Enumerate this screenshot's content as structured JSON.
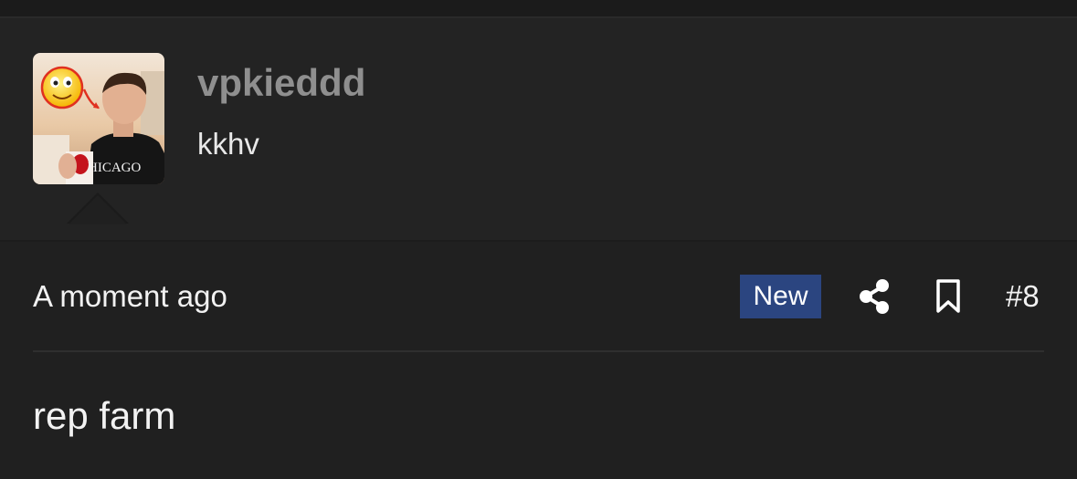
{
  "user": {
    "username": "vpkieddd",
    "title": "kkhv",
    "avatar_label": "HICAGO"
  },
  "post": {
    "timestamp": "A moment ago",
    "badge": "New",
    "number": "#8",
    "body": "rep farm"
  },
  "icons": {
    "share": "share-icon",
    "bookmark": "bookmark-icon"
  },
  "colors": {
    "background": "#202020",
    "card": "#232323",
    "username": "#8f8f8f",
    "badge": "#2b4580"
  }
}
